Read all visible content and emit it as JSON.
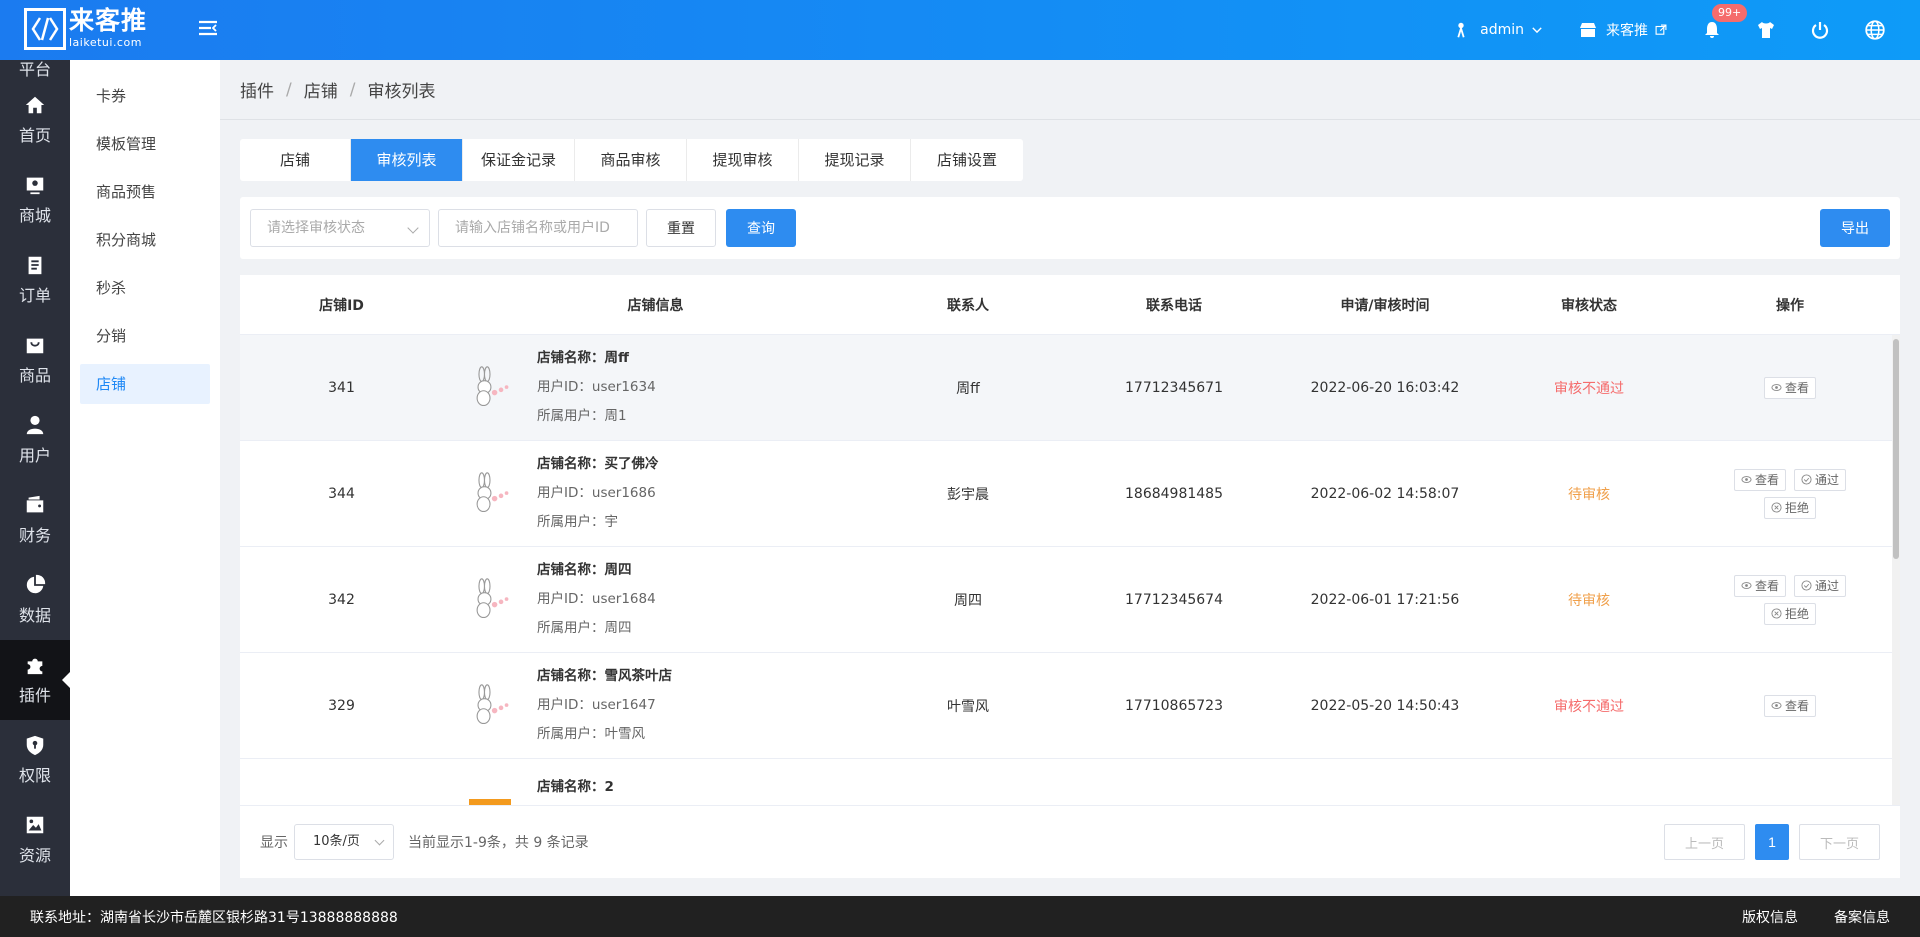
{
  "header": {
    "logo_cn": "来客推",
    "logo_en": "laiketui.com",
    "user": "admin",
    "store": "来客推",
    "notif_badge": "99+"
  },
  "sidebar": {
    "partial_top": "平台",
    "items": [
      {
        "label": "首页",
        "icon": "home-icon"
      },
      {
        "label": "商城",
        "icon": "store-icon"
      },
      {
        "label": "订单",
        "icon": "order-icon"
      },
      {
        "label": "商品",
        "icon": "goods-icon"
      },
      {
        "label": "用户",
        "icon": "user-icon"
      },
      {
        "label": "财务",
        "icon": "wallet-icon"
      },
      {
        "label": "数据",
        "icon": "pie-chart-icon"
      },
      {
        "label": "插件",
        "icon": "puzzle-icon"
      },
      {
        "label": "权限",
        "icon": "shield-icon"
      },
      {
        "label": "资源",
        "icon": "image-icon"
      }
    ]
  },
  "subnav": {
    "items": [
      "卡券",
      "模板管理",
      "商品预售",
      "积分商城",
      "秒杀",
      "分销",
      "店铺"
    ]
  },
  "breadcrumb": {
    "a": "插件",
    "b": "店铺",
    "c": "审核列表",
    "sep": "/"
  },
  "tabs": [
    "店铺",
    "审核列表",
    "保证金记录",
    "商品审核",
    "提现审核",
    "提现记录",
    "店铺设置"
  ],
  "filter": {
    "status_placeholder": "请选择审核状态",
    "search_placeholder": "请输入店铺名称或用户ID",
    "reset": "重置",
    "query": "查询",
    "export": "导出"
  },
  "table": {
    "headers": [
      "店铺ID",
      "店铺信息",
      "联系人",
      "联系电话",
      "申请/审核时间",
      "审核状态",
      "操作"
    ],
    "labels": {
      "name": "店铺名称：",
      "uid": "用户ID：",
      "owner": "所属用户："
    },
    "rows": [
      {
        "id": "341",
        "name": "周ff",
        "uid": "user1634",
        "owner": "周1",
        "contact": "周ff",
        "phone": "17712345671",
        "time": "2022-06-20 16:03:42",
        "status": "审核不通过"
      },
      {
        "id": "344",
        "name": "买了佛冷",
        "uid": "user1686",
        "owner": "宇",
        "contact": "彭宇晨",
        "phone": "18684981485",
        "time": "2022-06-02 14:58:07",
        "status": "待审核"
      },
      {
        "id": "342",
        "name": "周四",
        "uid": "user1684",
        "owner": "周四",
        "contact": "周四",
        "phone": "17712345674",
        "time": "2022-06-01 17:21:56",
        "status": "待审核"
      },
      {
        "id": "329",
        "name": "雪风茶叶店",
        "uid": "user1647",
        "owner": "叶雪风",
        "contact": "叶雪风",
        "phone": "17710865723",
        "time": "2022-05-20 14:50:43",
        "status": "审核不通过"
      },
      {
        "id": "",
        "name": "2",
        "uid": "",
        "owner": "",
        "contact": "",
        "phone": "",
        "time": "",
        "status": ""
      }
    ],
    "ops": {
      "view": "查看",
      "pass": "通过",
      "reject": "拒绝"
    }
  },
  "pager": {
    "show": "显示",
    "page_size": "10条/页",
    "summary": "当前显示1-9条，共 9 条记录",
    "prev": "上一页",
    "current": "1",
    "next": "下一页"
  },
  "footer": {
    "address": "联系地址：湖南省长沙市岳麓区银杉路31号13888888888",
    "copyright": "版权信息",
    "record": "备案信息"
  },
  "colors": {
    "primary": "#2e8cf0",
    "reject": "#f56c6c",
    "pending": "#f0a04b",
    "sidebar": "#2b2f3a"
  }
}
